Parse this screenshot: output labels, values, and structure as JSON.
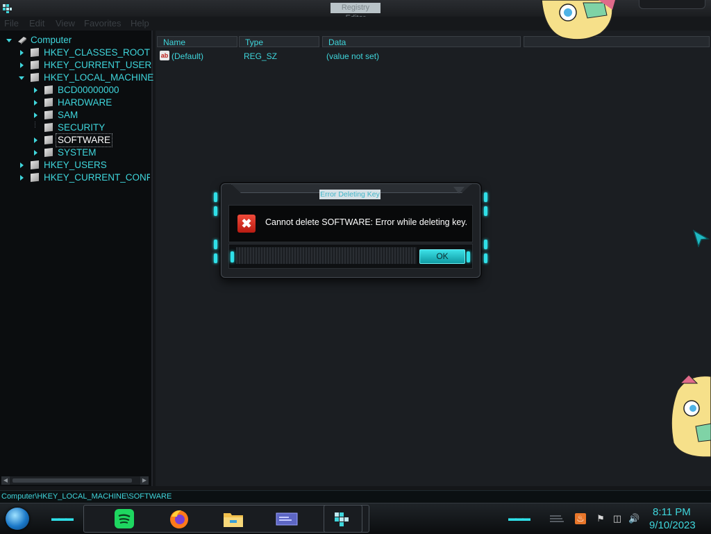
{
  "window": {
    "title": "Registry Editor"
  },
  "menu": {
    "items": [
      "File",
      "Edit",
      "View",
      "Favorites",
      "Help"
    ]
  },
  "tree": {
    "root": "Computer",
    "items": [
      {
        "label": "HKEY_CLASSES_ROOT"
      },
      {
        "label": "HKEY_CURRENT_USER"
      },
      {
        "label": "HKEY_LOCAL_MACHINE",
        "children": [
          {
            "label": "BCD00000000"
          },
          {
            "label": "HARDWARE"
          },
          {
            "label": "SAM"
          },
          {
            "label": "SECURITY"
          },
          {
            "label": "SOFTWARE",
            "selected": true
          },
          {
            "label": "SYSTEM"
          }
        ]
      },
      {
        "label": "HKEY_USERS"
      },
      {
        "label": "HKEY_CURRENT_CONFI"
      }
    ]
  },
  "list": {
    "columns": [
      "Name",
      "Type",
      "Data"
    ],
    "rows": [
      {
        "name": "(Default)",
        "type": "REG_SZ",
        "data": "(value not set)",
        "icon": "ab-string-icon"
      }
    ]
  },
  "status": {
    "path": "Computer\\HKEY_LOCAL_MACHINE\\SOFTWARE"
  },
  "dialog": {
    "title": "Error Deleting Key",
    "message": "Cannot delete SOFTWARE:  Error while deleting key.",
    "ok_label": "OK",
    "icon": "error-icon"
  },
  "taskbar": {
    "apps": [
      "spotify-icon",
      "firefox-icon",
      "file-explorer-icon",
      "window-preview-icon",
      "registry-editor-icon"
    ],
    "tray_icons": [
      "java-icon",
      "flag-icon",
      "network-icon",
      "volume-icon"
    ],
    "time": "8:11 PM",
    "date": "9/10/2023"
  },
  "colors": {
    "accent": "#3fd6dc",
    "background": "#141619",
    "error": "#d8261b"
  }
}
